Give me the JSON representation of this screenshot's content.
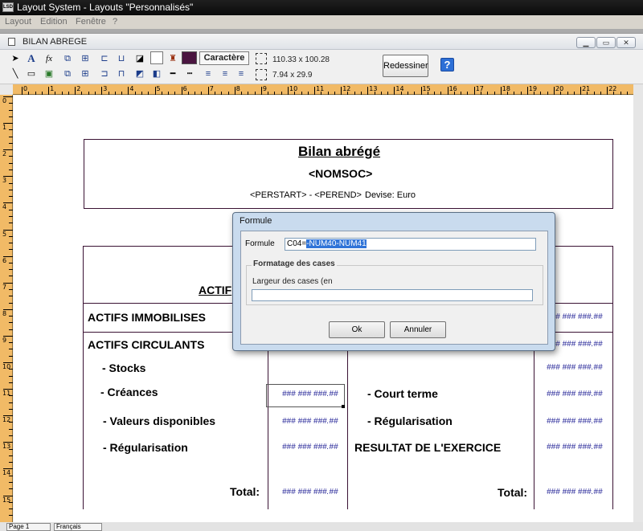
{
  "app": {
    "title": "Layout System - Layouts \"Personnalisés\"",
    "icon_label": "LSD"
  },
  "menu": [
    "Layout",
    "Edition",
    "Fenêtre",
    "?"
  ],
  "child_window": {
    "title": "BILAN ABREGE",
    "buttons": [
      "minimize-icon",
      "restore-icon",
      "close-icon"
    ]
  },
  "toolbar": {
    "caractere_label": "Caractère",
    "size_label": "110.33 x 100.28",
    "pos_label": "7.94 x 29.9",
    "redessiner_label": "Redessiner",
    "help_label": "?",
    "fill_color": "#ffffff",
    "text_color": "#4a1540"
  },
  "ruler": {
    "h_labels": [
      "0",
      "1",
      "2",
      "3",
      "4",
      "5",
      "6",
      "7",
      "8",
      "9",
      "10",
      "11",
      "12",
      "13",
      "14",
      "15",
      "16",
      "17",
      "18",
      "19",
      "20",
      "21",
      "22"
    ],
    "v_labels": [
      "0",
      "1",
      "2",
      "3",
      "4",
      "5",
      "6",
      "7",
      "8",
      "9",
      "10",
      "11",
      "12",
      "13",
      "14",
      "15"
    ]
  },
  "report": {
    "title": "Bilan abrégé",
    "company": "<NOMSOC>",
    "period": "<PERSTART>  - <PEREND>",
    "currency": "Devise: Euro",
    "actif_header": "ACTIF",
    "rows_left": [
      "ACTIFS IMMOBILISES",
      "ACTIFS CIRCULANTS",
      "- Stocks",
      "- Créances",
      "- Valeurs disponibles",
      "- Régularisation"
    ],
    "rows_right": [
      "- Court terme",
      "- Régularisation",
      "RESULTAT DE L'EXERCICE"
    ],
    "total_label": "Total:",
    "placeholder_value": "### ### ###.##"
  },
  "status": {
    "page_combo": "Page 1",
    "lang_combo": "Français"
  },
  "dialog": {
    "title": "Formule",
    "formule_label": "Formule",
    "formule_prefix": "C04=",
    "formule_selected": "-NUM40-NUM41",
    "group_label": "Formatage des cases",
    "largeur_label": "Largeur des cases (en",
    "largeur_value": "",
    "ok_label": "Ok",
    "cancel_label": "Annuler"
  }
}
